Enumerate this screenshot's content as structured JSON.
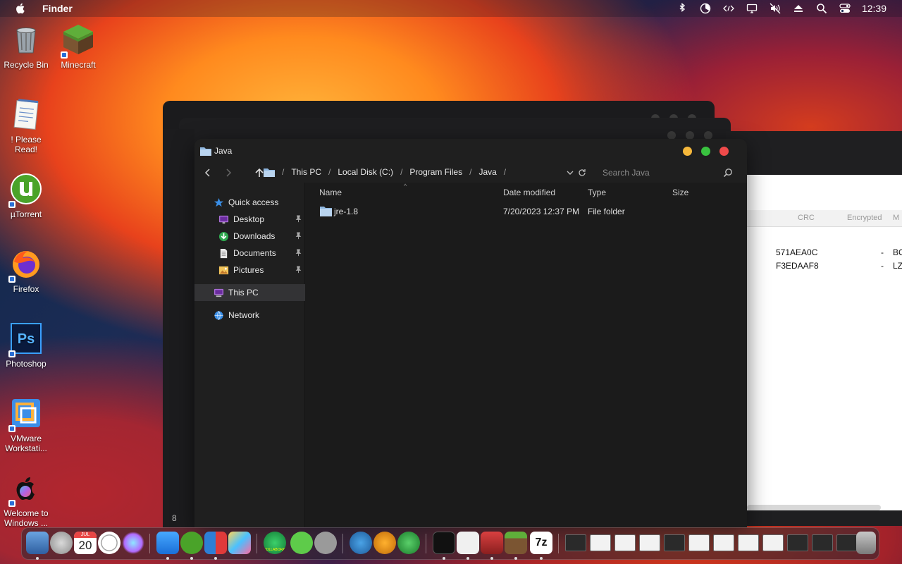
{
  "menubar": {
    "app_name": "Finder",
    "clock": "12:39",
    "status_icons": [
      "bluetooth-icon",
      "timer-icon",
      "code-icon",
      "display-icon",
      "mute-icon",
      "eject-icon",
      "search-icon",
      "control-center-icon"
    ]
  },
  "desktop": {
    "icons": [
      {
        "label": "Recycle Bin",
        "icon": "recycle-bin-icon"
      },
      {
        "label": "Minecraft",
        "icon": "minecraft-icon"
      },
      {
        "label": "! Please Read!",
        "icon": "notepad-icon"
      },
      {
        "label": "µTorrent",
        "icon": "utorrent-icon"
      },
      {
        "label": "Firefox",
        "icon": "firefox-icon"
      },
      {
        "label": "Photoshop",
        "icon": "photoshop-icon"
      },
      {
        "label": "VMware Workstati...",
        "icon": "vmware-icon"
      },
      {
        "label": "Welcome to Windows ...",
        "icon": "apple-logo-icon"
      }
    ]
  },
  "background_window": {
    "side_number": "8",
    "header": {
      "crc": "CRC",
      "encrypted": "Encrypted",
      "m": "M"
    },
    "rows": [
      {
        "crc": "571AEA0C",
        "encrypted": "-",
        "method": "BC"
      },
      {
        "crc": "F3EDAAF8",
        "encrypted": "-",
        "method": "LZ"
      }
    ]
  },
  "explorer": {
    "title": "Java",
    "breadcrumbs": [
      "This PC",
      "Local Disk (C:)",
      "Program Files",
      "Java"
    ],
    "search_placeholder": "Search Java",
    "sidebar": {
      "quick_access": "Quick access",
      "pinned": [
        {
          "label": "Desktop",
          "icon": "desktop-icon"
        },
        {
          "label": "Downloads",
          "icon": "downloads-icon"
        },
        {
          "label": "Documents",
          "icon": "documents-icon"
        },
        {
          "label": "Pictures",
          "icon": "pictures-icon"
        }
      ],
      "this_pc": "This PC",
      "network": "Network"
    },
    "columns": {
      "name": "Name",
      "date": "Date modified",
      "type": "Type",
      "size": "Size"
    },
    "files": [
      {
        "name": "jre-1.8",
        "date": "7/20/2023 12:37 PM",
        "type": "File folder",
        "size": ""
      }
    ]
  },
  "dock": {
    "date_icon": {
      "month": "JUL",
      "day": "20"
    },
    "sevenzip_label": "7z",
    "gpu_label": "COLLABORATOR"
  },
  "colors": {
    "accent_blue": "#3a8ee6",
    "traffic_close": "#ef4a4a",
    "traffic_min": "#f6b83b",
    "traffic_max": "#39c23f",
    "window_bg": "#1f1f1f"
  }
}
